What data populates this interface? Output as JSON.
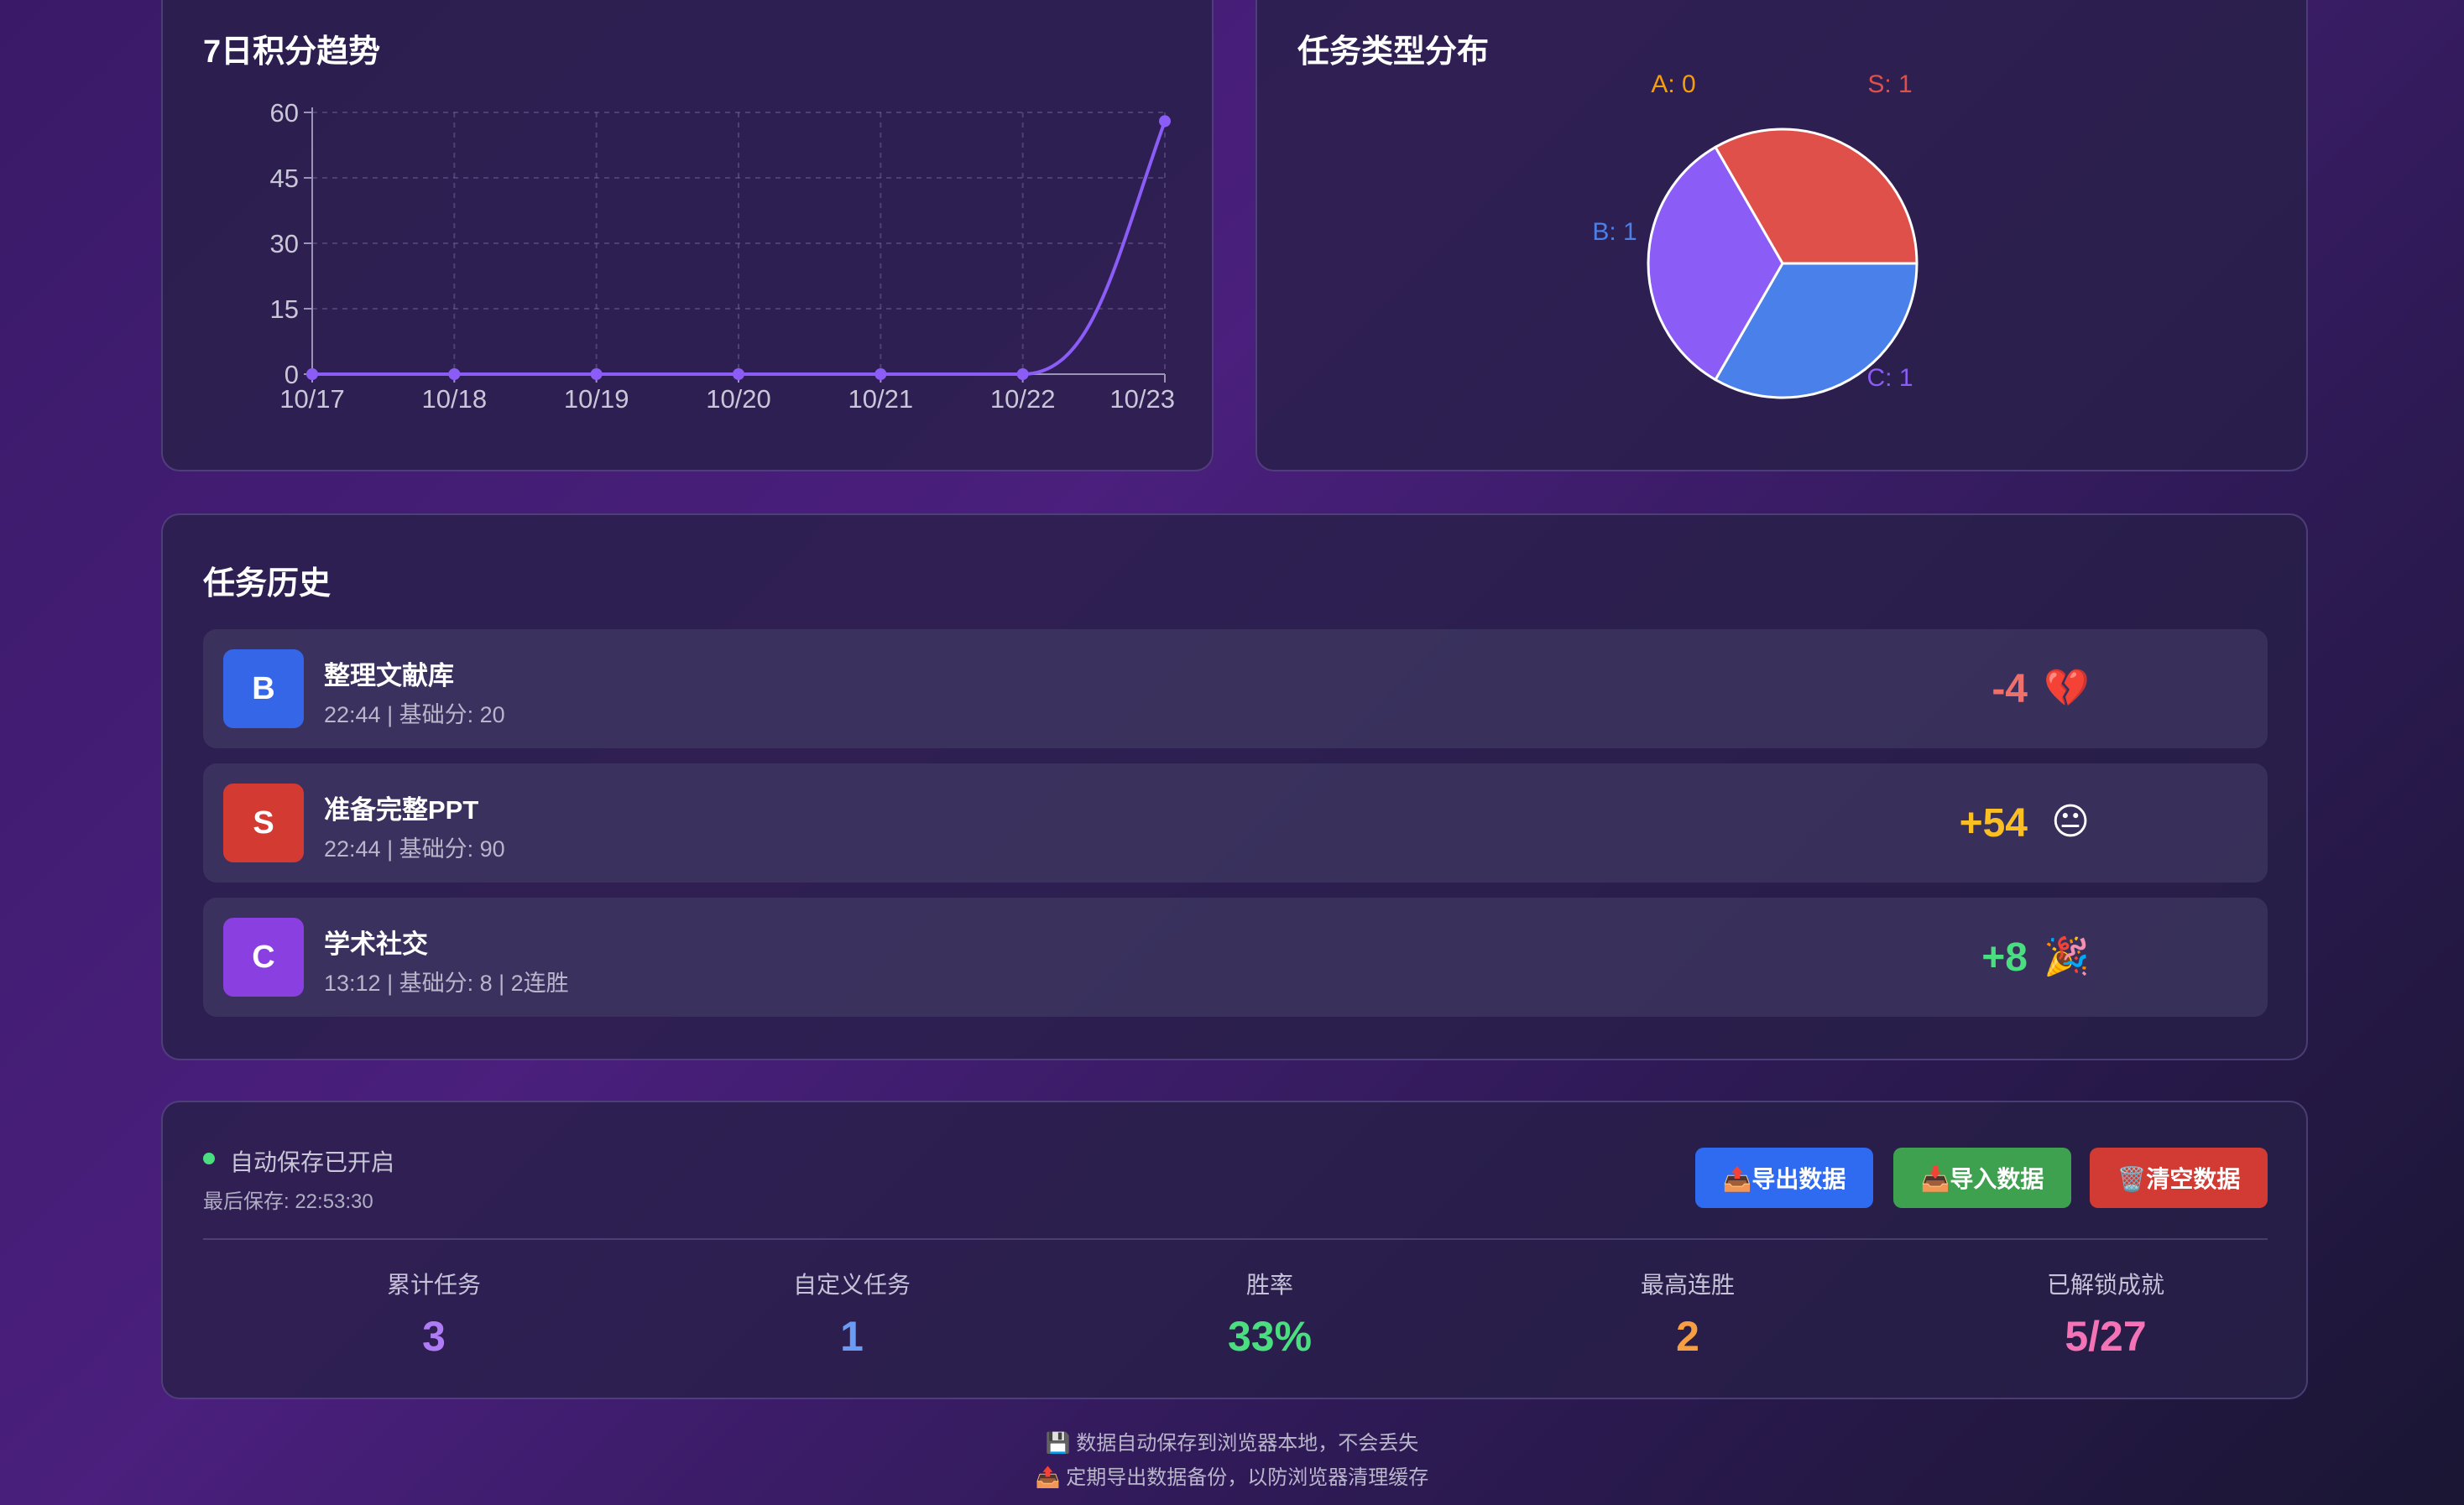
{
  "trend": {
    "title": "7日积分趋势"
  },
  "chart_data": [
    {
      "type": "line",
      "title": "7日积分趋势",
      "categories": [
        "10/17",
        "10/18",
        "10/19",
        "10/20",
        "10/21",
        "10/22",
        "10/23"
      ],
      "values": [
        0,
        0,
        0,
        0,
        0,
        0,
        58
      ],
      "ylim": [
        0,
        60
      ],
      "yticks": [
        0,
        15,
        30,
        45,
        60
      ],
      "grid": true,
      "color": "#8b5cf6"
    },
    {
      "type": "pie",
      "title": "任务类型分布",
      "slices": [
        {
          "label": "S: 1",
          "name": "S",
          "value": 1,
          "color": "#e0504a"
        },
        {
          "label": "A: 0",
          "name": "A",
          "value": 0,
          "color": "#f59e0b"
        },
        {
          "label": "B: 1",
          "name": "B",
          "value": 1,
          "color": "#4a80ea"
        },
        {
          "label": "C: 1",
          "name": "C",
          "value": 1,
          "color": "#8b5cf6"
        }
      ]
    }
  ],
  "pie": {
    "title": "任务类型分布"
  },
  "history": {
    "title": "任务历史",
    "items": [
      {
        "grade": "B",
        "grade_color": "#3566e8",
        "name": "整理文献库",
        "meta": "22:44 | 基础分: 20",
        "score": "-4",
        "score_color": "#ef6f6a",
        "emoji": "💔"
      },
      {
        "grade": "S",
        "grade_color": "#d33b32",
        "name": "准备完整PPT",
        "meta": "22:44 | 基础分: 90",
        "score": "+54",
        "score_color": "#fbbf24",
        "emoji": "😐"
      },
      {
        "grade": "C",
        "grade_color": "#8a3fe0",
        "name": "学术社交",
        "meta": "13:12 | 基础分: 8 | 2连胜",
        "score": "+8",
        "score_color": "#4ade80",
        "emoji": "🎉"
      }
    ]
  },
  "save": {
    "status": "自动保存已开启",
    "last_saved": "最后保存: 22:53:30"
  },
  "buttons": {
    "export": "📤导出数据",
    "import": "📥导入数据",
    "clear": "🗑️清空数据"
  },
  "stats": [
    {
      "label": "累计任务",
      "value": "3",
      "color": "#b07cf5"
    },
    {
      "label": "自定义任务",
      "value": "1",
      "color": "#6b9cf5"
    },
    {
      "label": "胜率",
      "value": "33%",
      "color": "#4ade80"
    },
    {
      "label": "最高连胜",
      "value": "2",
      "color": "#f59e42"
    },
    {
      "label": "已解锁成就",
      "value": "5/27",
      "color": "#f472b6"
    }
  ],
  "footer": {
    "line1": "💾 数据自动保存到浏览器本地，不会丢失",
    "line2": "📤 定期导出数据备份，以防浏览器清理缓存"
  }
}
